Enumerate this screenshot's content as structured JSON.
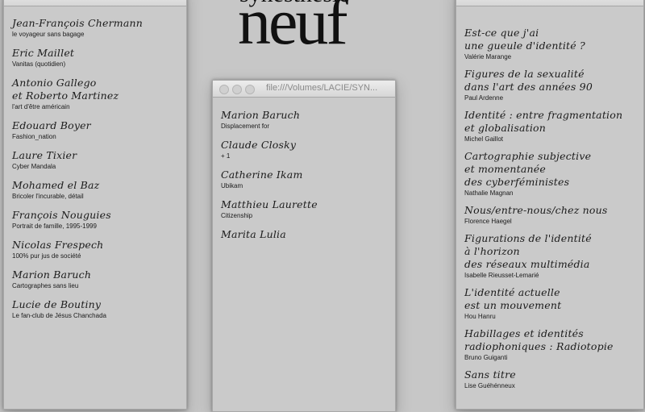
{
  "logo": {
    "top_text": "synesthesie",
    "main_text": "neuf"
  },
  "middle_window": {
    "title": "file:///Volumes/LACIE/SYN...",
    "items": [
      {
        "name": "Marion Baruch",
        "sub": "Displacement for"
      },
      {
        "name": "Claude Closky",
        "sub": "+ 1"
      },
      {
        "name": "Catherine Ikam",
        "sub": "Ubikam"
      },
      {
        "name": "Matthieu Laurette",
        "sub": "Citizenship"
      },
      {
        "name": "Marita Lulia",
        "sub": ""
      }
    ]
  },
  "left_window": {
    "items": [
      {
        "name": "Jean-François Chermann",
        "sub": "le voyageur sans bagage"
      },
      {
        "name": "Eric Maillet",
        "sub": "Vanitas (quotidien)"
      },
      {
        "name": "Antonio Gallego\net Roberto Martinez",
        "sub": "l'art d'être américain"
      },
      {
        "name": "Edouard Boyer",
        "sub": "Fashion_nation"
      },
      {
        "name": "Laure Tixier",
        "sub": "Cyber Mandala"
      },
      {
        "name": "Mohamed el Baz",
        "sub": "Bricoler l'incurable, détail"
      },
      {
        "name": "François Nouguies",
        "sub": "Portrait de famille, 1995-1999"
      },
      {
        "name": "Nicolas Frespech",
        "sub": "100% pur jus de société"
      },
      {
        "name": "Marion Baruch",
        "sub": "Cartographes sans lieu"
      },
      {
        "name": "Lucie de Boutiny",
        "sub": "Le fan-club de Jésus Chanchada"
      }
    ]
  },
  "right_window": {
    "items": [
      {
        "name": "Est-ce que j'ai\nune gueule d'identité ?",
        "sub": "Valérie Marange"
      },
      {
        "name": "Figures de la sexualité\ndans l'art des années 90",
        "sub": "Paul Ardenne"
      },
      {
        "name": "Identité : entre fragmentation\net globalisation",
        "sub": "Michel Gaillot"
      },
      {
        "name": "Cartographie subjective\net momentanée\ndes cyberféministes",
        "sub": "Nathalie Magnan"
      },
      {
        "name": "Nous/entre-nous/chez nous",
        "sub": "Florence Haegel"
      },
      {
        "name": "Figurations de l'identité\nà l'horizon\ndes réseaux multimédia",
        "sub": "Isabelle Rieusset-Lemarié"
      },
      {
        "name": "L'identité actuelle\nest un mouvement",
        "sub": "Hou Hanru"
      },
      {
        "name": "Habillages et identités\nradiophoniques : Radiotopie",
        "sub": "Bruno Guiganti"
      },
      {
        "name": "Sans titre",
        "sub": "Lise Guéhénneux"
      }
    ]
  }
}
